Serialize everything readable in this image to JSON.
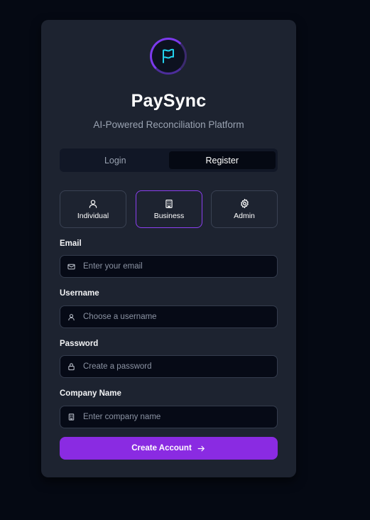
{
  "app": {
    "name": "PaySync",
    "tagline": "AI-Powered Reconciliation Platform"
  },
  "tabs": [
    {
      "label": "Login",
      "active": false
    },
    {
      "label": "Register",
      "active": true
    }
  ],
  "roles": [
    {
      "label": "Individual",
      "icon": "user-icon",
      "selected": false
    },
    {
      "label": "Business",
      "icon": "building-icon",
      "selected": true
    },
    {
      "label": "Admin",
      "icon": "gear-icon",
      "selected": false
    }
  ],
  "form": {
    "email": {
      "label": "Email",
      "placeholder": "Enter your email",
      "value": "",
      "icon": "mail-icon"
    },
    "username": {
      "label": "Username",
      "placeholder": "Choose a username",
      "value": "",
      "icon": "user-icon"
    },
    "password": {
      "label": "Password",
      "placeholder": "Create a password",
      "value": "",
      "icon": "lock-icon"
    },
    "company": {
      "label": "Company Name",
      "placeholder": "Enter company name",
      "value": "",
      "icon": "building-icon"
    }
  },
  "submit": {
    "label": "Create Account",
    "icon": "arrow-right-icon"
  },
  "colors": {
    "background": "#050913",
    "card": "#1d2330",
    "accent": "#8a2be2",
    "logo_flag": "#22d3ee"
  }
}
